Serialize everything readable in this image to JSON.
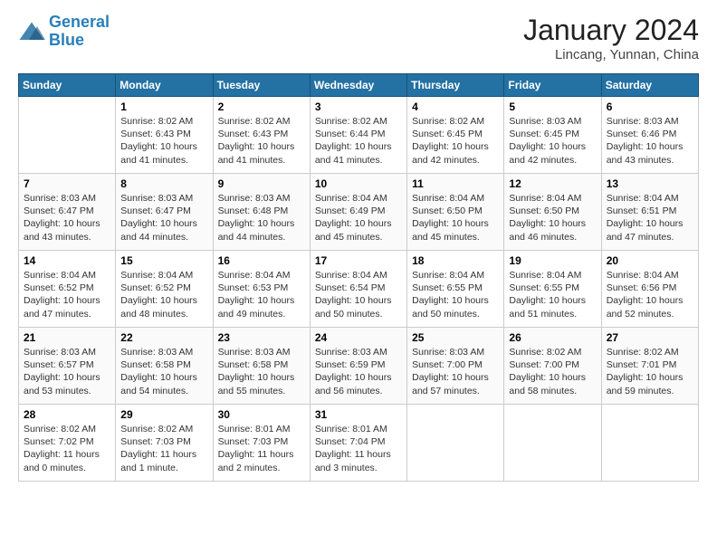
{
  "logo": {
    "line1": "General",
    "line2": "Blue"
  },
  "title": "January 2024",
  "location": "Lincang, Yunnan, China",
  "weekdays": [
    "Sunday",
    "Monday",
    "Tuesday",
    "Wednesday",
    "Thursday",
    "Friday",
    "Saturday"
  ],
  "weeks": [
    [
      {
        "day": "",
        "info": ""
      },
      {
        "day": "1",
        "info": "Sunrise: 8:02 AM\nSunset: 6:43 PM\nDaylight: 10 hours\nand 41 minutes."
      },
      {
        "day": "2",
        "info": "Sunrise: 8:02 AM\nSunset: 6:43 PM\nDaylight: 10 hours\nand 41 minutes."
      },
      {
        "day": "3",
        "info": "Sunrise: 8:02 AM\nSunset: 6:44 PM\nDaylight: 10 hours\nand 41 minutes."
      },
      {
        "day": "4",
        "info": "Sunrise: 8:02 AM\nSunset: 6:45 PM\nDaylight: 10 hours\nand 42 minutes."
      },
      {
        "day": "5",
        "info": "Sunrise: 8:03 AM\nSunset: 6:45 PM\nDaylight: 10 hours\nand 42 minutes."
      },
      {
        "day": "6",
        "info": "Sunrise: 8:03 AM\nSunset: 6:46 PM\nDaylight: 10 hours\nand 43 minutes."
      }
    ],
    [
      {
        "day": "7",
        "info": "Sunrise: 8:03 AM\nSunset: 6:47 PM\nDaylight: 10 hours\nand 43 minutes."
      },
      {
        "day": "8",
        "info": "Sunrise: 8:03 AM\nSunset: 6:47 PM\nDaylight: 10 hours\nand 44 minutes."
      },
      {
        "day": "9",
        "info": "Sunrise: 8:03 AM\nSunset: 6:48 PM\nDaylight: 10 hours\nand 44 minutes."
      },
      {
        "day": "10",
        "info": "Sunrise: 8:04 AM\nSunset: 6:49 PM\nDaylight: 10 hours\nand 45 minutes."
      },
      {
        "day": "11",
        "info": "Sunrise: 8:04 AM\nSunset: 6:50 PM\nDaylight: 10 hours\nand 45 minutes."
      },
      {
        "day": "12",
        "info": "Sunrise: 8:04 AM\nSunset: 6:50 PM\nDaylight: 10 hours\nand 46 minutes."
      },
      {
        "day": "13",
        "info": "Sunrise: 8:04 AM\nSunset: 6:51 PM\nDaylight: 10 hours\nand 47 minutes."
      }
    ],
    [
      {
        "day": "14",
        "info": "Sunrise: 8:04 AM\nSunset: 6:52 PM\nDaylight: 10 hours\nand 47 minutes."
      },
      {
        "day": "15",
        "info": "Sunrise: 8:04 AM\nSunset: 6:52 PM\nDaylight: 10 hours\nand 48 minutes."
      },
      {
        "day": "16",
        "info": "Sunrise: 8:04 AM\nSunset: 6:53 PM\nDaylight: 10 hours\nand 49 minutes."
      },
      {
        "day": "17",
        "info": "Sunrise: 8:04 AM\nSunset: 6:54 PM\nDaylight: 10 hours\nand 50 minutes."
      },
      {
        "day": "18",
        "info": "Sunrise: 8:04 AM\nSunset: 6:55 PM\nDaylight: 10 hours\nand 50 minutes."
      },
      {
        "day": "19",
        "info": "Sunrise: 8:04 AM\nSunset: 6:55 PM\nDaylight: 10 hours\nand 51 minutes."
      },
      {
        "day": "20",
        "info": "Sunrise: 8:04 AM\nSunset: 6:56 PM\nDaylight: 10 hours\nand 52 minutes."
      }
    ],
    [
      {
        "day": "21",
        "info": "Sunrise: 8:03 AM\nSunset: 6:57 PM\nDaylight: 10 hours\nand 53 minutes."
      },
      {
        "day": "22",
        "info": "Sunrise: 8:03 AM\nSunset: 6:58 PM\nDaylight: 10 hours\nand 54 minutes."
      },
      {
        "day": "23",
        "info": "Sunrise: 8:03 AM\nSunset: 6:58 PM\nDaylight: 10 hours\nand 55 minutes."
      },
      {
        "day": "24",
        "info": "Sunrise: 8:03 AM\nSunset: 6:59 PM\nDaylight: 10 hours\nand 56 minutes."
      },
      {
        "day": "25",
        "info": "Sunrise: 8:03 AM\nSunset: 7:00 PM\nDaylight: 10 hours\nand 57 minutes."
      },
      {
        "day": "26",
        "info": "Sunrise: 8:02 AM\nSunset: 7:00 PM\nDaylight: 10 hours\nand 58 minutes."
      },
      {
        "day": "27",
        "info": "Sunrise: 8:02 AM\nSunset: 7:01 PM\nDaylight: 10 hours\nand 59 minutes."
      }
    ],
    [
      {
        "day": "28",
        "info": "Sunrise: 8:02 AM\nSunset: 7:02 PM\nDaylight: 11 hours\nand 0 minutes."
      },
      {
        "day": "29",
        "info": "Sunrise: 8:02 AM\nSunset: 7:03 PM\nDaylight: 11 hours\nand 1 minute."
      },
      {
        "day": "30",
        "info": "Sunrise: 8:01 AM\nSunset: 7:03 PM\nDaylight: 11 hours\nand 2 minutes."
      },
      {
        "day": "31",
        "info": "Sunrise: 8:01 AM\nSunset: 7:04 PM\nDaylight: 11 hours\nand 3 minutes."
      },
      {
        "day": "",
        "info": ""
      },
      {
        "day": "",
        "info": ""
      },
      {
        "day": "",
        "info": ""
      }
    ]
  ]
}
